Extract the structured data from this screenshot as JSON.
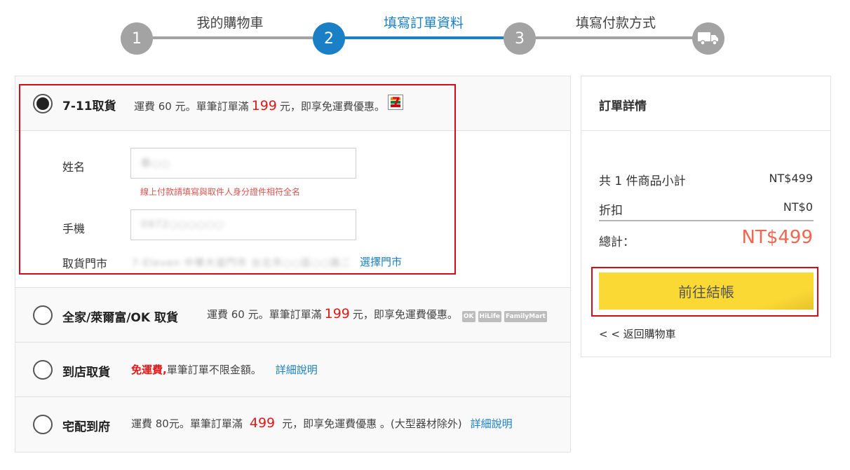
{
  "stepper": {
    "steps": [
      {
        "num": "1",
        "label": "我的購物車"
      },
      {
        "num": "2",
        "label": "填寫訂單資料"
      },
      {
        "num": "3",
        "label": "填寫付款方式"
      }
    ],
    "final_icon": "delivery-truck-icon"
  },
  "shipping": {
    "option_711": {
      "title": "7-11取貨",
      "desc_prefix": "運費 60 元。單筆訂單滿",
      "threshold": "199",
      "desc_suffix": "元，即享免運費優惠。",
      "logo": "7-eleven-logo-icon"
    },
    "form": {
      "name_label": "姓名",
      "name_value": "蔡○○",
      "name_hint": "線上付款請填寫與取件人身分證件相符全名",
      "phone_label": "手機",
      "phone_value": "0972○○○○○○",
      "store_label": "取貨門市",
      "store_value": "7-Eleven 中華大道門市 台北市○○區○○路二段12號",
      "choose_store": "選擇門市"
    },
    "option_family": {
      "title": "全家/萊爾富/OK 取貨",
      "desc_prefix": "運費 60 元。單筆訂單滿",
      "threshold": "199",
      "desc_suffix": "元，即享免運費優惠。",
      "logos": [
        "OK",
        "HiLife",
        "FamilyMart"
      ]
    },
    "option_store": {
      "title": "到店取貨",
      "free_text": "免運費,",
      "desc": " 單筆訂單不限金額。",
      "link": "詳細說明"
    },
    "option_home": {
      "title": "宅配到府",
      "desc_prefix": "運費 80元。單筆訂單滿",
      "threshold": "499",
      "desc_suffix": "元，即享免運費優惠 。(大型器材除外)",
      "link": "詳細說明"
    }
  },
  "order": {
    "title": "訂單詳情",
    "subtotal_label": "共 1 件商品小計",
    "subtotal_value": "NT$499",
    "discount_label": "折扣",
    "discount_value": "NT$0",
    "total_label": "總計：",
    "total_value": "NT$499",
    "checkout_label": "前往結帳",
    "back_label": "< < 返回購物車"
  },
  "colors": {
    "accent_blue": "#1a7fc4",
    "inactive_gray": "#a3a3a3",
    "price_red": "#e01818",
    "total_coral": "#f06751",
    "checkout_yellow": "#fbd935",
    "highlight_frame": "#d80c18"
  }
}
